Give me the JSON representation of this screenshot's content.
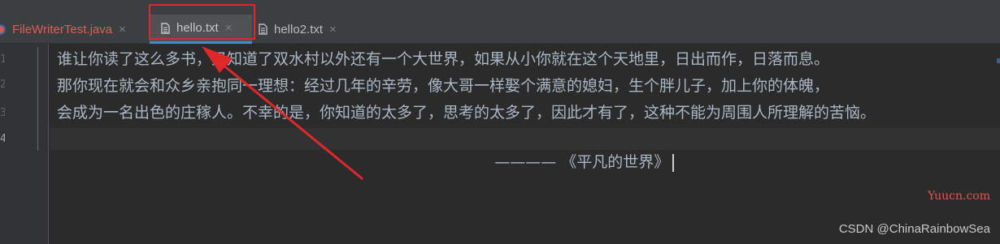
{
  "tabs": [
    {
      "label": "FileWriterTest.java",
      "icon": "java-class-icon",
      "active": false
    },
    {
      "label": "hello.txt",
      "icon": "text-file-icon",
      "active": true
    },
    {
      "label": "hello2.txt",
      "icon": "text-file-icon",
      "active": false
    }
  ],
  "close_glyph": "×",
  "gutter": {
    "line_numbers": [
      "1",
      "2",
      "3",
      "4"
    ],
    "current_line": "4"
  },
  "editor": {
    "lines": [
      "谁让你读了这么多书，又知道了双水村以外还有一个大世界，如果从小你就在这个天地里，日出而作，日落而息。",
      "那你现在就会和众乡亲抱同一理想：经过几年的辛劳，像大哥一样娶个满意的媳妇，生个胖儿子，加上你的体魄，",
      "会成为一名出色的庄稼人。不幸的是，你知道的太多了，思考的太多了，因此才有了，这种不能为周围人所理解的苦恼。",
      "———— 《平凡的世界》"
    ]
  },
  "watermarks": {
    "site": "Yuucn.com",
    "author": "CSDN @ChinaRainbowSea"
  },
  "colors": {
    "annotation": "#e0282b",
    "active_tab_underline": "#4a88c7",
    "editor_bg": "#2b2b2b",
    "text": "#a9b7c6"
  }
}
